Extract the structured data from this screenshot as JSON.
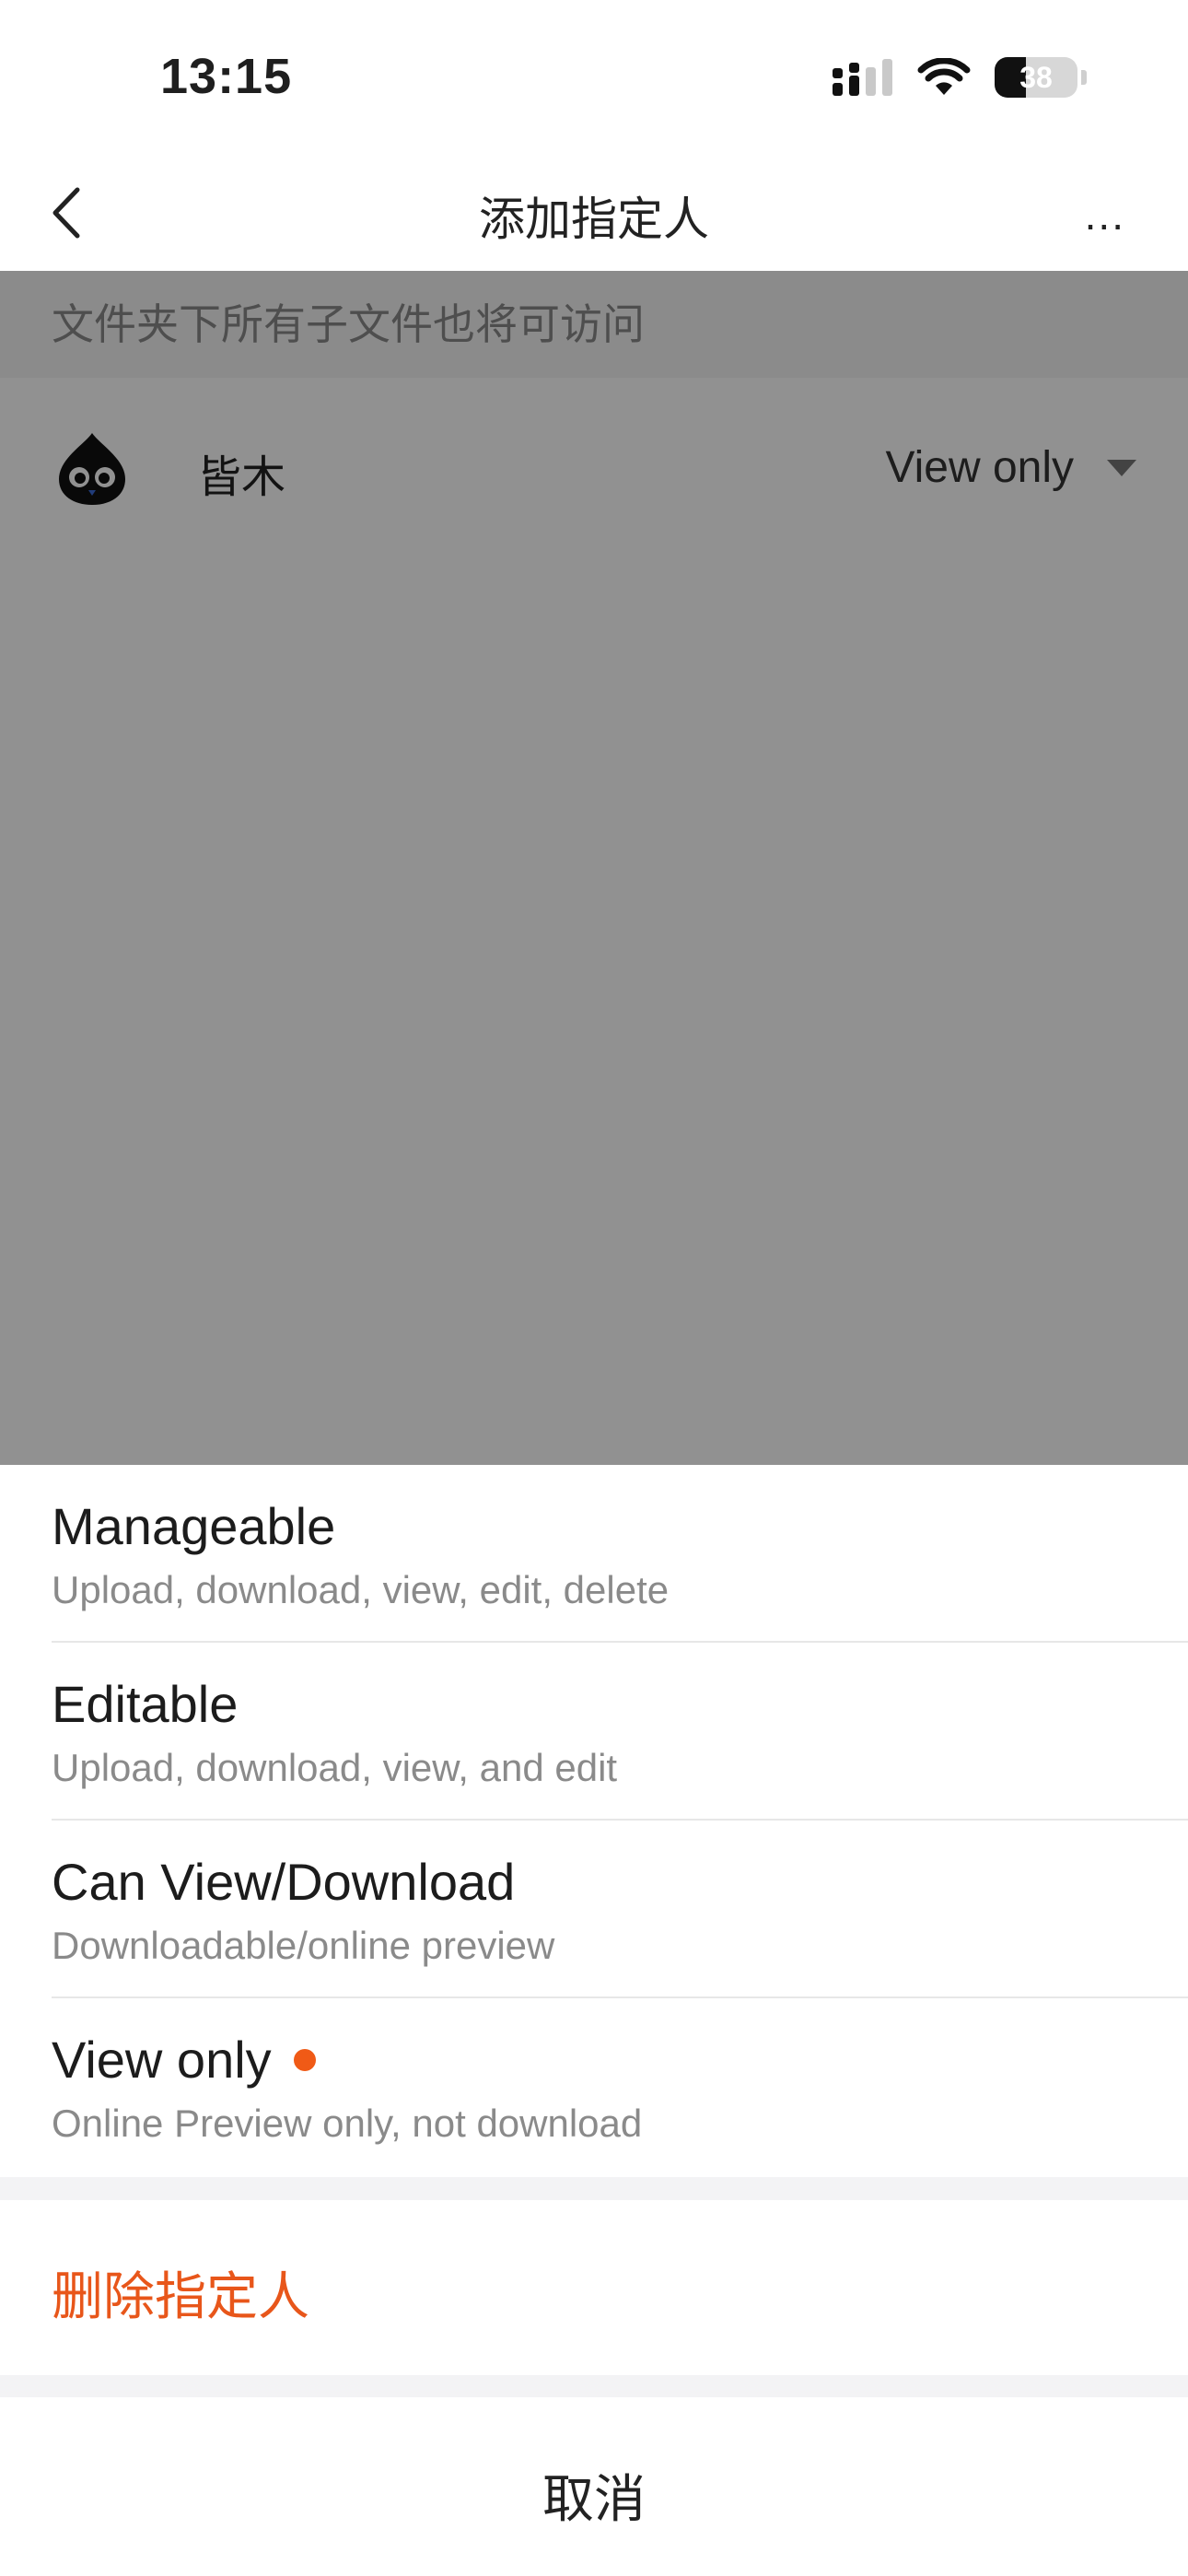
{
  "status_bar": {
    "time": "13:15",
    "battery_level": "38",
    "icons": [
      "cellular-signal-icon",
      "wifi-icon",
      "battery-icon"
    ]
  },
  "nav": {
    "title": "添加指定人",
    "more": "...",
    "back_icon": "chevron-left-icon"
  },
  "content": {
    "notice": "文件夹下所有子文件也将可访问",
    "member": {
      "name": "皆木",
      "permission": "View only"
    }
  },
  "sheet": {
    "options": [
      {
        "title": "Manageable",
        "desc": "Upload, download, view, edit, delete",
        "selected": false
      },
      {
        "title": "Editable",
        "desc": "Upload, download, view, and edit",
        "selected": false
      },
      {
        "title": "Can View/Download",
        "desc": "Downloadable/online preview",
        "selected": false
      },
      {
        "title": "View only",
        "desc": "Online Preview only, not download",
        "selected": true
      }
    ],
    "delete_label": "删除指定人",
    "cancel_label": "取消"
  },
  "colors": {
    "accent": "#f05a16",
    "danger": "#e8561a",
    "overlay": "rgba(0,0,0,0.43)"
  }
}
